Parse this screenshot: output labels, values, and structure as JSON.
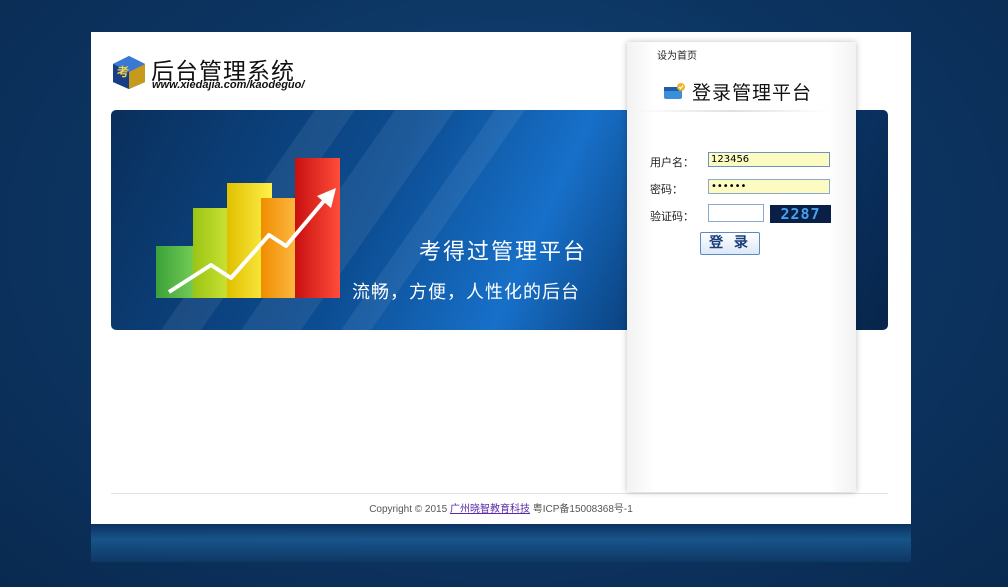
{
  "header": {
    "title": "后台管理系统",
    "url": "www.xiedajia.com/kaodeguo/"
  },
  "banner": {
    "title": "考得过管理平台",
    "subtitle": "流畅，方便，人性化的后台"
  },
  "login": {
    "set_homepage": "设为首页",
    "title": "登录管理平台",
    "username_label": "用户名：",
    "username_value": "123456",
    "password_label": "密码：",
    "password_value": "••••••",
    "captcha_label": "验证码：",
    "captcha_value": "",
    "captcha_code": "2287",
    "submit_label": "登 录"
  },
  "footer": {
    "copyright": "Copyright © 2015",
    "company": "广州晓智教育科技",
    "icp": "粤ICP备15008368号-1"
  },
  "colors": {
    "background": "#0c3461",
    "banner": "#0c4d92",
    "input_fill": "#fbfbc2",
    "link": "#5b2aa8"
  }
}
